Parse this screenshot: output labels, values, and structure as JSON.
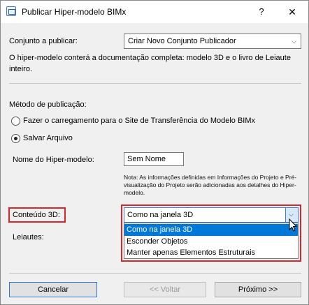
{
  "window": {
    "title": "Publicar Hiper-modelo BIMx",
    "help": "?",
    "close": "✕"
  },
  "conjunto": {
    "label": "Conjunto a publicar:",
    "value": "Criar Novo Conjunto Publicador"
  },
  "info_text": "O hiper-modelo conterá a documentação completa: modelo 3D e o livro de Leiaute inteiro.",
  "metodo": {
    "label": "Método de publicação:",
    "options": [
      {
        "label": "Fazer o carregamento para o Site de Transferência do Modelo BIMx",
        "checked": false
      },
      {
        "label": "Salvar Arquivo",
        "checked": true
      }
    ]
  },
  "nome": {
    "label": "Nome do Hiper-modelo:",
    "value": "Sem Nome"
  },
  "note": "Nota: As informações definidas em Informações do Projeto e Pré-visualização do Projeto serão adicionadas aos detalhes do Hiper-modelo.",
  "conteudo": {
    "label": "Conteúdo 3D:",
    "value": "Como na janela 3D",
    "options": [
      "Como na janela 3D",
      "Esconder Objetos",
      "Manter apenas Elementos Estruturais"
    ],
    "selected_index": 0
  },
  "leiautes": {
    "label": "Leiautes:"
  },
  "buttons": {
    "cancel": "Cancelar",
    "back": "<< Voltar",
    "next": "Próximo >>"
  },
  "colors": {
    "highlight_red": "#d9262b",
    "selection_blue": "#0078d7"
  }
}
